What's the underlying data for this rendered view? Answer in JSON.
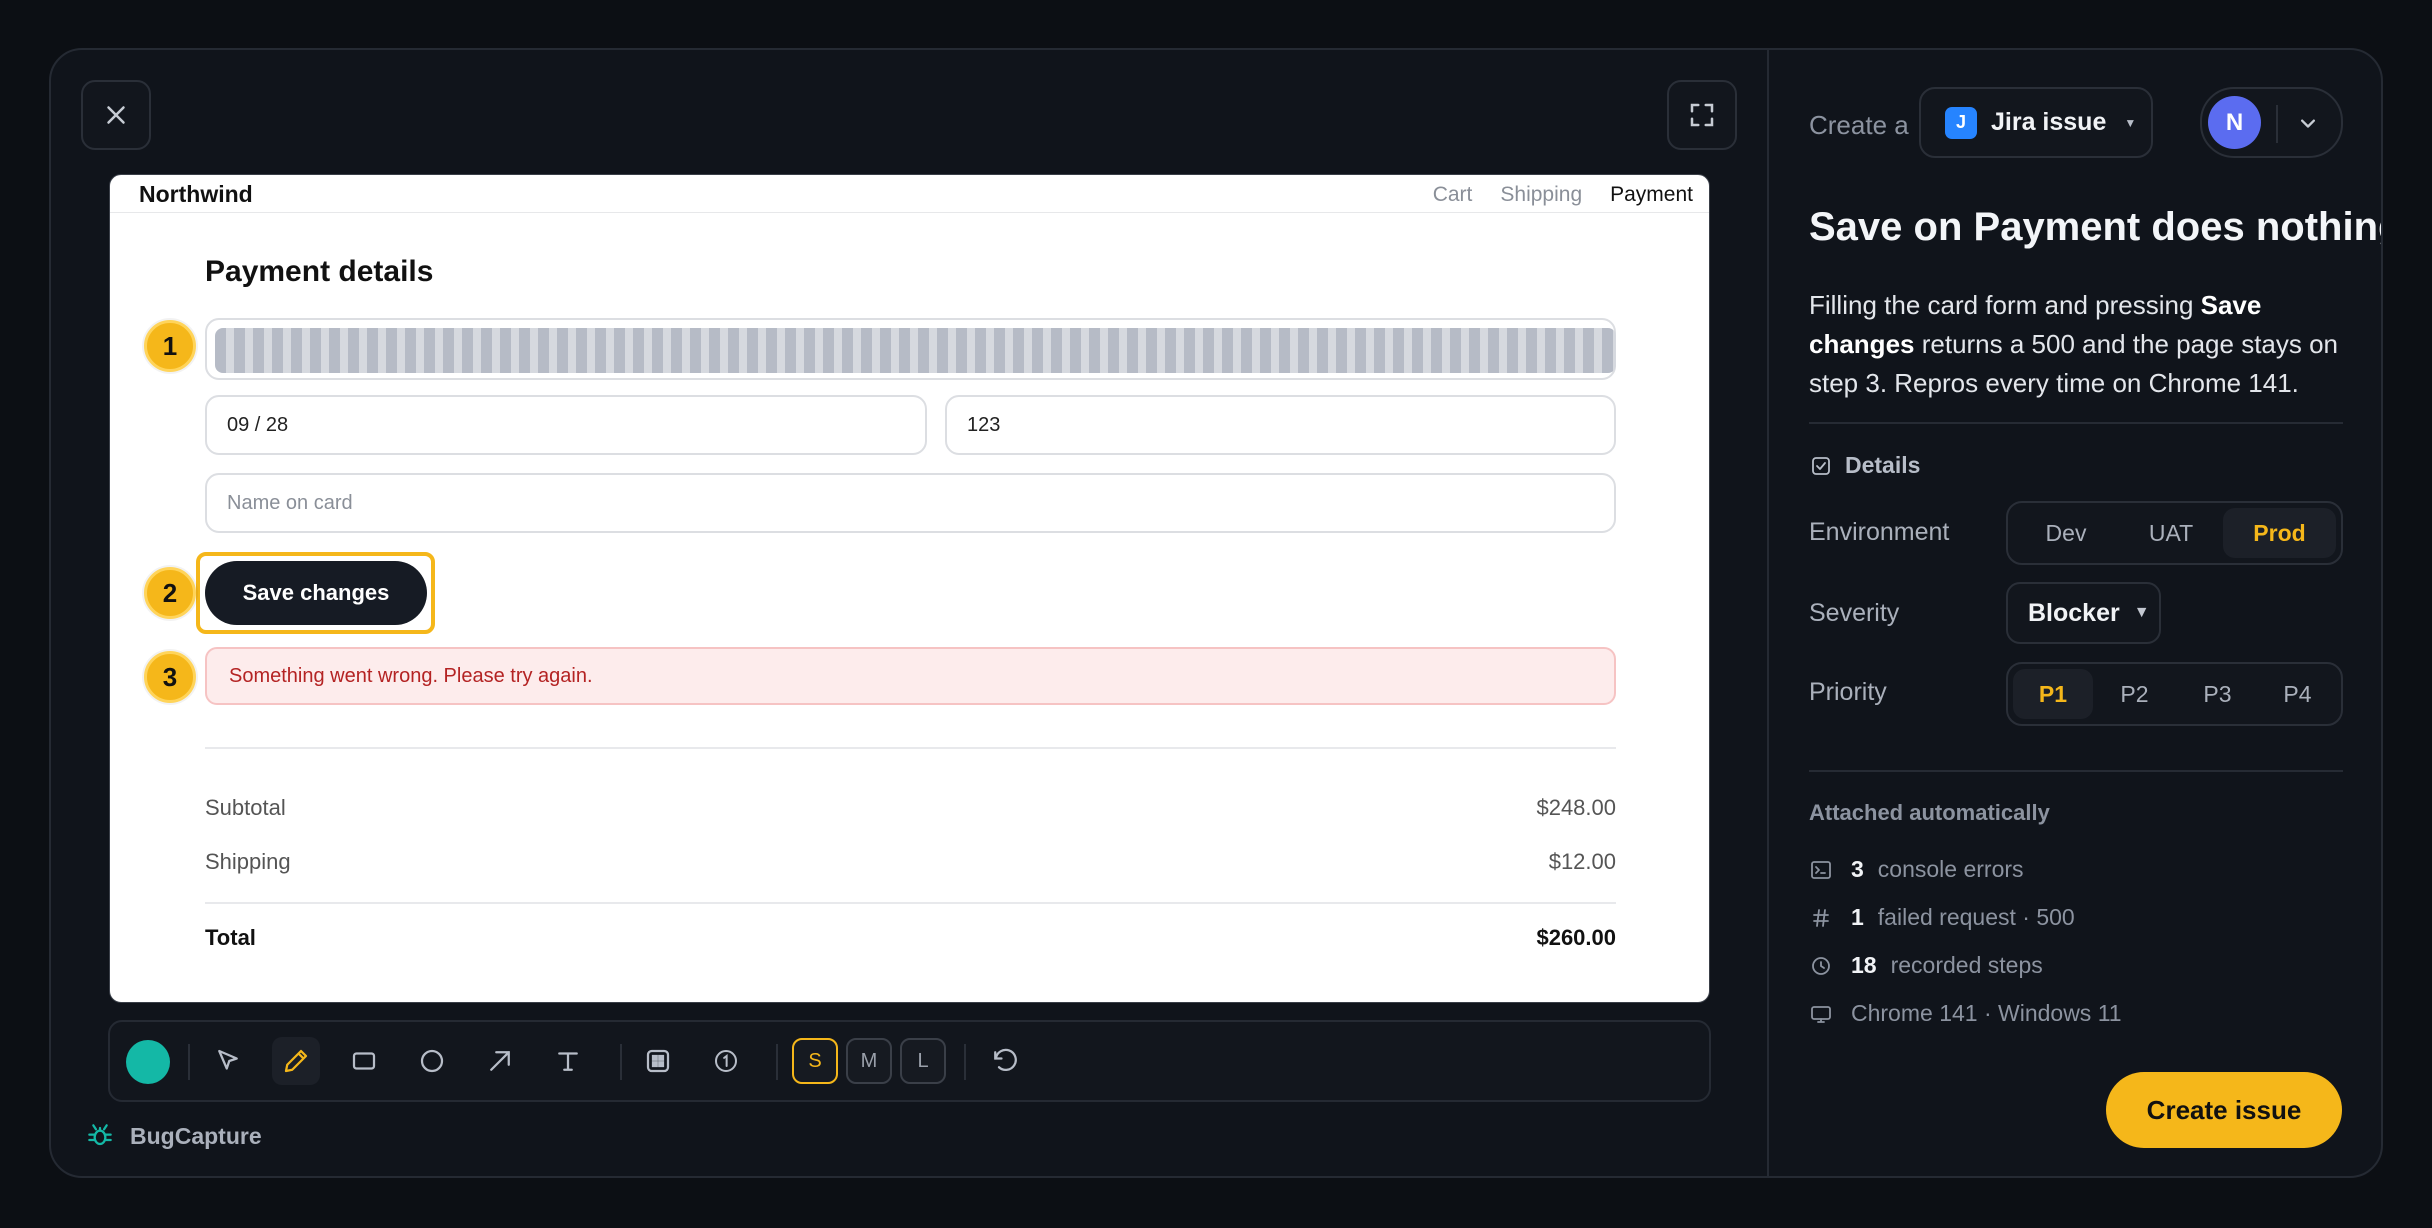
{
  "screenshot": {
    "brand": "Northwind",
    "steps": [
      "Cart",
      "Shipping",
      "Payment"
    ],
    "active_step": "Payment",
    "section_title": "Payment details",
    "expiry_value": "09 / 28",
    "cvc_value": "123",
    "name_placeholder": "Name on card",
    "save_label": "Save changes",
    "error_text": "Something went wrong. Please try again.",
    "summary": {
      "subtotal_label": "Subtotal",
      "subtotal_value": "$248.00",
      "shipping_label": "Shipping",
      "shipping_value": "$12.00",
      "total_label": "Total",
      "total_value": "$260.00"
    },
    "markers": [
      "1",
      "2",
      "3"
    ]
  },
  "toolbar": {
    "color": "#14b8a6",
    "tools": [
      "color-picker",
      "select-arrow-icon",
      "pencil-icon",
      "rectangle-icon",
      "circle-icon",
      "arrow-icon",
      "text-icon",
      "blur-icon",
      "step-marker-icon"
    ],
    "active_tool": "pencil",
    "sizes": [
      "S",
      "M",
      "L"
    ],
    "active_size": "S"
  },
  "app": {
    "name": "BugCapture"
  },
  "panel": {
    "create_label": "Create a",
    "tracker_letter": "J",
    "tracker_label": "Jira issue",
    "user_initial": "N",
    "title": "Save on Payment does nothing",
    "desc_1": "Filling the card form and pressing ",
    "desc_bold": "Save changes",
    "desc_2": " returns a 500 and the page stays on step 3. Repros every time on Chrome 141.",
    "details_label": "Details",
    "environment_label": "Environment",
    "environments": [
      "Dev",
      "UAT",
      "Prod"
    ],
    "environment_selected": "Prod",
    "severity_label": "Severity",
    "severity_value": "Blocker",
    "priority_label": "Priority",
    "priorities": [
      "P1",
      "P2",
      "P3",
      "P4"
    ],
    "priority_selected": "P1",
    "attached_label": "Attached automatically",
    "attachments": [
      {
        "count": "3",
        "text": "console errors"
      },
      {
        "count": "1",
        "text": "failed request · 500"
      },
      {
        "count": "18",
        "text": "recorded steps"
      },
      {
        "count": "",
        "text": "Chrome 141 · Windows 11"
      }
    ],
    "create_button": "Create issue"
  },
  "colors": {
    "accent": "#f5b71a",
    "error_bg": "#fdecec",
    "error_text": "#b42323"
  }
}
